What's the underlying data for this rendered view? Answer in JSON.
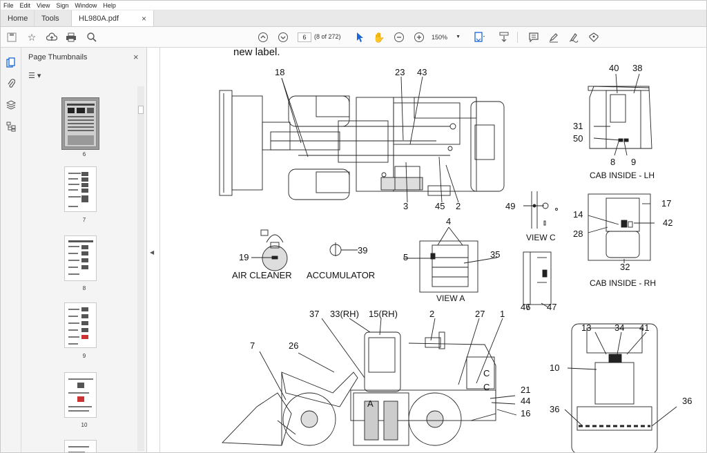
{
  "menu": [
    "File",
    "Edit",
    "View",
    "Sign",
    "Window",
    "Help"
  ],
  "tabs": {
    "home": "Home",
    "tools": "Tools",
    "document": "HL980A.pdf",
    "close": "×"
  },
  "toolbar": {
    "page_number": "6",
    "page_count": "(8 of 272)",
    "zoom": "150%",
    "icons": [
      "save-icon",
      "bookmark-star-icon",
      "upload-cloud-icon",
      "print-icon",
      "find-zoom-icon",
      "prev-page-icon",
      "next-page-icon",
      "select-arrow-icon",
      "hand-icon",
      "zoom-out-icon",
      "zoom-in-icon",
      "fit-page-icon",
      "scroll-mode-icon",
      "comment-icon",
      "highlight-icon",
      "fill-sign-icon",
      "share-stamp-icon"
    ]
  },
  "sidebar": {
    "title": "Page Thumbnails",
    "close": "×",
    "options_icon": "thumbnail-options-icon",
    "thumbnails": [
      {
        "label": "6",
        "selected": true
      },
      {
        "label": "7",
        "selected": false
      },
      {
        "label": "8",
        "selected": false
      },
      {
        "label": "9",
        "selected": false
      },
      {
        "label": "10",
        "selected": false
      }
    ]
  },
  "document": {
    "heading": "new label.",
    "captions": {
      "cab_lh": "CAB INSIDE - LH",
      "cab_rh": "CAB INSIDE - RH",
      "air_cleaner": "AIR CLEANER",
      "accumulator": "ACCUMULATOR",
      "view_a": "VIEW A",
      "view_c": "VIEW C"
    },
    "callouts": {
      "c18": "18",
      "c23": "23",
      "c43": "43",
      "c3": "3",
      "c45": "45",
      "c2a": "2",
      "c40": "40",
      "c38": "38",
      "c31": "31",
      "c50": "50",
      "c8": "8",
      "c9": "9",
      "c49": "49",
      "c17": "17",
      "c14": "14",
      "c42": "42",
      "c28": "28",
      "c32": "32",
      "c19": "19",
      "c39": "39",
      "c4": "4",
      "c5": "5",
      "c35": "35",
      "c46": "46",
      "c47": "47",
      "c37": "37",
      "c33": "33(RH)",
      "c15": "15(RH)",
      "c2b": "2",
      "c27": "27",
      "c1": "1",
      "c7": "7",
      "c26": "26",
      "cC1": "C",
      "cC2": "C",
      "cA": "A",
      "c21": "21",
      "c44": "44",
      "c16": "16",
      "c13": "13",
      "c34": "34",
      "c41": "41",
      "c10": "10",
      "c36a": "36",
      "c36b": "36"
    }
  }
}
